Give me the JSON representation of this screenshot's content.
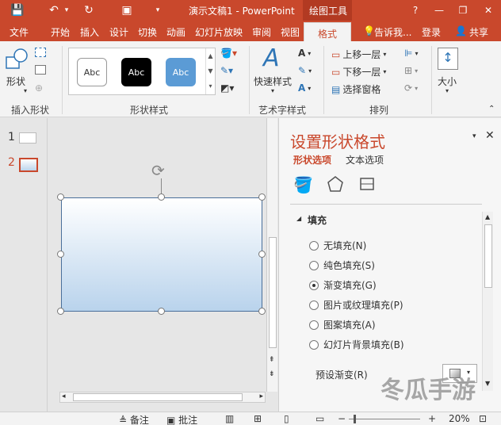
{
  "window": {
    "title": "演示文稿1 - PowerPoint",
    "context_tab": "绘图工具",
    "help": "?",
    "minimize": "—",
    "restore": "❐",
    "close": "✕"
  },
  "qat": {
    "save": "💾",
    "undo": "↶",
    "undo_more": "▾",
    "redo": "↻",
    "present": "▣",
    "customize": "▾"
  },
  "tabs": [
    "文件",
    "开始",
    "插入",
    "设计",
    "切换",
    "动画",
    "幻灯片放映",
    "审阅",
    "视图",
    "格式"
  ],
  "tell_me": "告诉我...",
  "login": "登录",
  "share": "共享",
  "ribbon": {
    "insert_shapes": {
      "shapes_label": "形状",
      "group": "插入形状"
    },
    "shape_styles": {
      "group": "形状样式",
      "swatch_text": [
        "Abc",
        "Abc",
        "Abc"
      ],
      "swatch_colors": [
        "#ffffff",
        "#000000",
        "#5b9bd5"
      ]
    },
    "wordart": {
      "quick_styles": "快速样式",
      "group": "艺术字样式",
      "glyph": "A"
    },
    "arrange": {
      "bring_forward": "上移一层",
      "send_backward": "下移一层",
      "selection_pane": "选择窗格",
      "group": "排列"
    },
    "size": {
      "label": "大小"
    }
  },
  "slides": [
    {
      "num": "1"
    },
    {
      "num": "2"
    }
  ],
  "pane": {
    "title": "设置形状格式",
    "subtabs": [
      "形状选项",
      "文本选项"
    ],
    "section": "填充",
    "fill_options": [
      {
        "label": "无填充(N)",
        "selected": false
      },
      {
        "label": "纯色填充(S)",
        "selected": false
      },
      {
        "label": "渐变填充(G)",
        "selected": true
      },
      {
        "label": "图片或纹理填充(P)",
        "selected": false
      },
      {
        "label": "图案填充(A)",
        "selected": false
      },
      {
        "label": "幻灯片背景填充(B)",
        "selected": false
      }
    ],
    "preset_gradient_label": "预设渐变(R)"
  },
  "status": {
    "notes": "备注",
    "comments": "批注",
    "zoom": "20%"
  },
  "watermark": "冬瓜手游"
}
